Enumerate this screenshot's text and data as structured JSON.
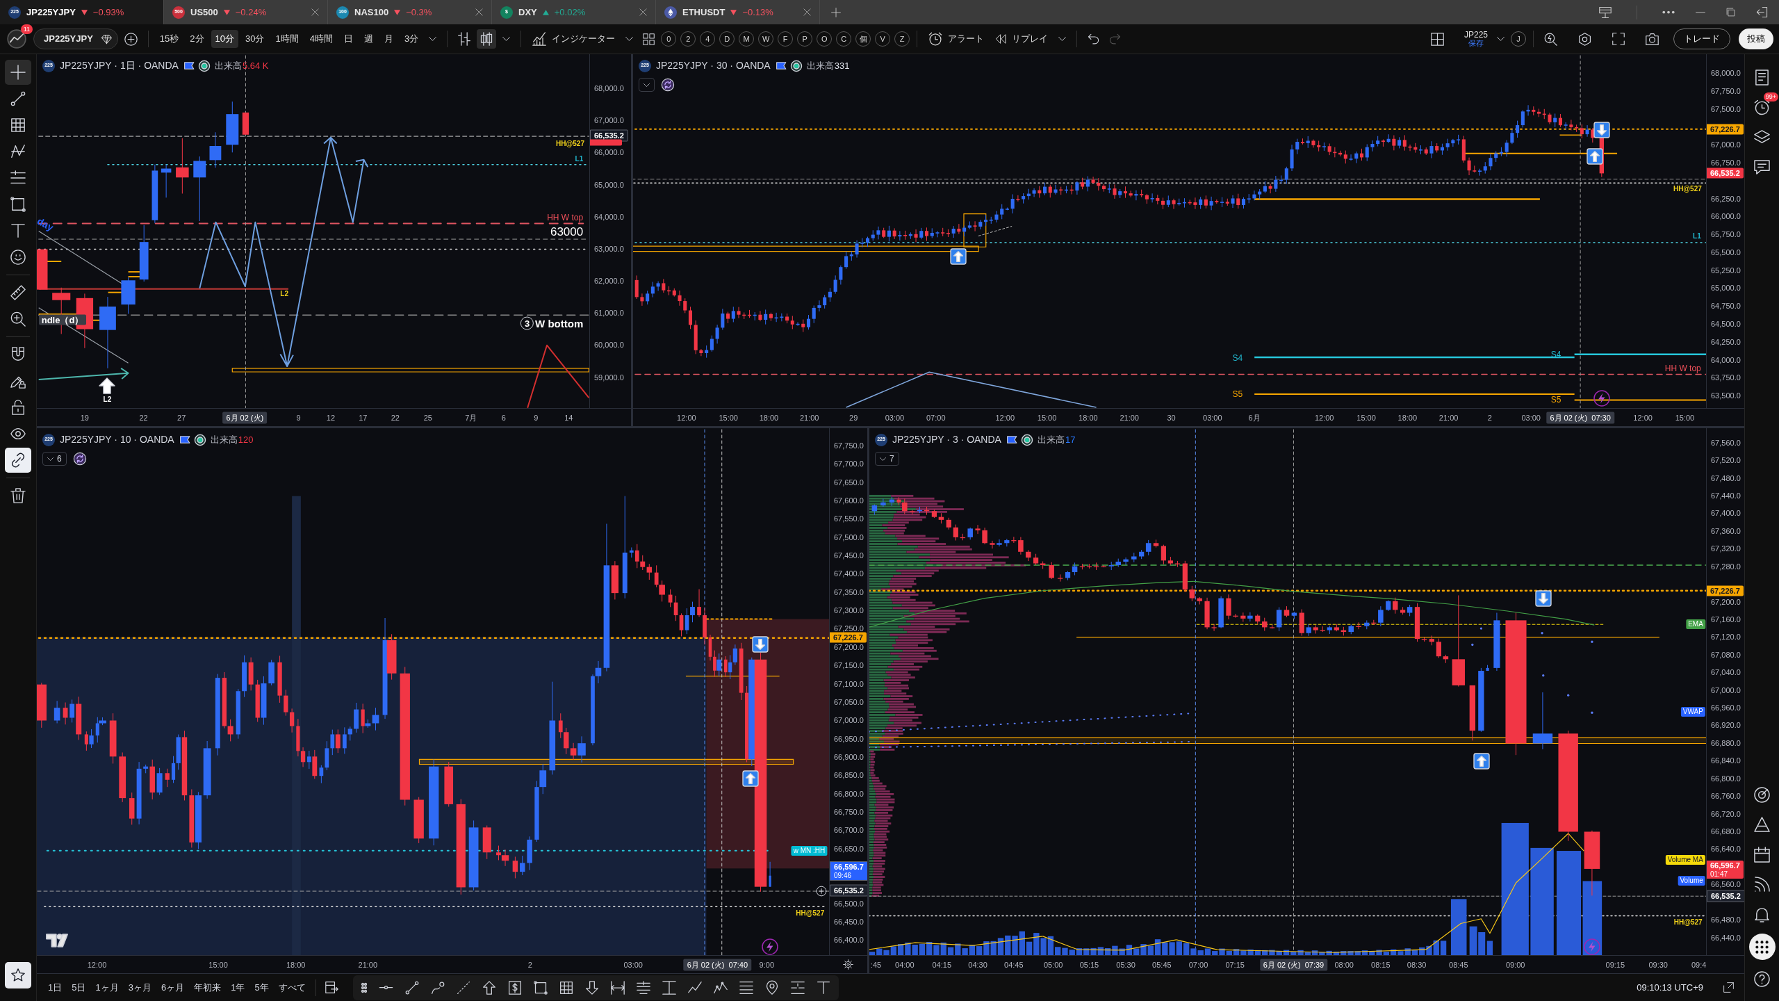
{
  "tabs": [
    {
      "badge": "225",
      "color": "#1f3e73",
      "symbol": "JP225YJPY",
      "change": "−0.93%",
      "negative": true,
      "selected": true,
      "closable": false
    },
    {
      "badge": "500",
      "color": "#c9303c",
      "symbol": "US500",
      "change": "−0.24%",
      "negative": true,
      "selected": false,
      "closable": true
    },
    {
      "badge": "100",
      "color": "#1b88b0",
      "symbol": "NAS100",
      "change": "−0.3%",
      "negative": true,
      "selected": false,
      "closable": true
    },
    {
      "badge": "$",
      "color": "#13835f",
      "symbol": "DXY",
      "change": "+0.02%",
      "negative": false,
      "selected": false,
      "closable": true
    },
    {
      "color": "#4b5aa6",
      "symbol": "ETHUSDT",
      "change": "−0.13%",
      "negative": true,
      "selected": false,
      "closable": true
    }
  ],
  "toolbar": {
    "notifications": "11",
    "symbol": "JP225YJPY",
    "intervals": [
      {
        "label": "15秒",
        "selected": false
      },
      {
        "label": "2分",
        "selected": false
      },
      {
        "label": "10分",
        "selected": true
      },
      {
        "label": "30分",
        "selected": false
      },
      {
        "label": "1時間",
        "selected": false
      },
      {
        "label": "4時間",
        "selected": false
      },
      {
        "label": "日",
        "selected": false
      },
      {
        "label": "週",
        "selected": false
      },
      {
        "label": "月",
        "selected": false
      },
      {
        "label": "3分",
        "selected": false
      }
    ],
    "chart_types": [
      {
        "kind": "bars",
        "selected": false
      },
      {
        "kind": "candles",
        "selected": true
      }
    ],
    "indicators": "インジケーター",
    "quick_buttons": [
      "0",
      "2",
      "4",
      "D",
      "M",
      "W",
      "F",
      "P",
      "O",
      "C",
      "個",
      "V",
      "Z"
    ],
    "alert": "アラート",
    "replay": "リプレイ",
    "undo_disabled": false,
    "redo_disabled": true,
    "layout_name": "JP225",
    "layout_status": "保存",
    "user_initial": "J",
    "trade": "トレード",
    "publish": "投稿"
  },
  "drawing_tools": [
    [
      {
        "kind": "crosshair",
        "selected": true
      },
      {
        "kind": "trend_line",
        "selected": false
      },
      {
        "kind": "grid",
        "selected": false
      },
      {
        "kind": "pattern",
        "selected": false
      },
      {
        "kind": "fib",
        "selected": false
      },
      {
        "kind": "rectangle",
        "selected": false
      },
      {
        "kind": "text",
        "selected": false
      },
      {
        "kind": "emoji",
        "selected": false
      }
    ],
    [
      {
        "kind": "ruler",
        "selected": false
      },
      {
        "kind": "zoom",
        "selected": false
      }
    ],
    [
      {
        "kind": "magnet",
        "selected": false
      },
      {
        "kind": "draw_lock",
        "selected": false
      },
      {
        "kind": "lock",
        "selected": false
      },
      {
        "kind": "eye",
        "selected": false
      },
      {
        "kind": "link",
        "selected": true
      }
    ],
    [
      {
        "kind": "trash",
        "selected": false
      }
    ]
  ],
  "side_panel": {
    "top": [
      {
        "kind": "watchlist",
        "selected": false
      },
      {
        "kind": "alerts",
        "badge": "99+",
        "selected": false
      },
      {
        "kind": "layers",
        "selected": false
      },
      {
        "kind": "chat",
        "selected": false
      }
    ],
    "bottom": [
      {
        "kind": "target",
        "selected": false
      },
      {
        "kind": "pyramid",
        "selected": false
      },
      {
        "kind": "calendar",
        "selected": false
      },
      {
        "kind": "broadcast",
        "selected": false
      },
      {
        "kind": "bell",
        "selected": false
      },
      {
        "kind": "apps",
        "selected": true
      },
      {
        "kind": "help",
        "selected": false
      }
    ]
  },
  "charts": [
    {
      "badge": "225",
      "title": "JP225YJPY · 1日 · OANDA",
      "volume": {
        "label": "出来高",
        "value": "5.64 K",
        "color": "#f23645"
      },
      "indicator_toggle": false,
      "linked": false,
      "price_ticks": [
        "68,000.0",
        "67,000.0",
        "66,000.0",
        "65,000.0",
        "64,000.0",
        "63,000.0",
        "62,000.0",
        "61,000.0",
        "60,000.0",
        "59,000.0"
      ],
      "price_badges": [
        {
          "text": "66,535.2",
          "color": "#131722"
        },
        {
          "color": "#f23645"
        }
      ],
      "time_ticks": [
        "19",
        "22",
        "27",
        "9",
        "12",
        "17",
        "22",
        "25",
        "7月",
        "6",
        "9",
        "14"
      ],
      "time_cursor": "6月 02 (火)",
      "labels": [
        {
          "kind": "text",
          "text": "HH@527",
          "color": "#f2d21b"
        },
        {
          "kind": "text",
          "text": "L1",
          "color": "#22b8cf"
        },
        {
          "kind": "text",
          "text": "HH W top",
          "color": "#f0505a"
        },
        {
          "kind": "text",
          "text": "63000",
          "color": "#ffffff"
        },
        {
          "kind": "numbered",
          "number": "3",
          "text": "W bottom",
          "color": "#ffffff"
        },
        {
          "kind": "text",
          "text": "L2",
          "color": "#f2d21b"
        },
        {
          "kind": "text",
          "text": "L2",
          "color": "#ffffff"
        },
        {
          "kind": "tag",
          "text": "ndle（d）",
          "color": "#3b3e46"
        },
        {
          "kind": "text",
          "text": "day",
          "color": "#2962ff"
        }
      ]
    },
    {
      "badge": "225",
      "title": "JP225YJPY · 30 · OANDA",
      "volume": {
        "label": "出来高",
        "value": "331",
        "color": "#e0e3eb"
      },
      "indicator_toggle": true,
      "linked": true,
      "price_ticks": [
        "68,000.0",
        "67,750.0",
        "67,500.0",
        "67,000.0",
        "66,750.0",
        "66,250.0",
        "66,000.0",
        "65,750.0",
        "65,500.0",
        "65,250.0",
        "65,000.0",
        "64,750.0",
        "64,500.0",
        "64,250.0",
        "64,000.0",
        "63,750.0",
        "63,500.0"
      ],
      "price_badges": [
        {
          "text": "67,226.7",
          "color": "#f7a600"
        },
        {
          "text": "66,535.2",
          "color": "#f23645"
        }
      ],
      "time_ticks": [
        "12:00",
        "15:00",
        "18:00",
        "21:00",
        "29",
        "03:00",
        "07:00",
        "12:00",
        "15:00",
        "18:00",
        "21:00",
        "30",
        "03:00",
        "6月",
        "12:00",
        "15:00",
        "18:00",
        "21:00",
        "2",
        "03:00",
        "12:00",
        "15:00"
      ],
      "time_cursor": "6月 02 (火)  07:30",
      "labels": [
        {
          "kind": "text",
          "text": "HH@527",
          "color": "#f2d21b"
        },
        {
          "kind": "text",
          "text": "L1",
          "color": "#22b8cf"
        },
        {
          "kind": "text",
          "text": "S4",
          "color": "#22b8cf"
        },
        {
          "kind": "text",
          "text": "S4",
          "color": "#22b8cf"
        },
        {
          "kind": "text",
          "text": "HH W top",
          "color": "#f0505a"
        },
        {
          "kind": "text",
          "text": "S5",
          "color": "#f7a600"
        },
        {
          "kind": "text",
          "text": "S5",
          "color": "#f7a600"
        }
      ],
      "signals": [
        {
          "kind": "up"
        },
        {
          "kind": "down"
        },
        {
          "kind": "up"
        }
      ]
    },
    {
      "badge": "225",
      "title": "JP225YJPY · 10 · OANDA",
      "volume": {
        "label": "出来高",
        "value": "120",
        "color": "#f23645"
      },
      "indicator_toggle": true,
      "indicator_count": "6",
      "linked": true,
      "price_ticks": [
        "67,750.0",
        "67,700.0",
        "67,650.0",
        "67,600.0",
        "67,550.0",
        "67,500.0",
        "67,450.0",
        "67,400.0",
        "67,350.0",
        "67,300.0",
        "67,250.0",
        "67,200.0",
        "67,150.0",
        "67,100.0",
        "67,050.0",
        "67,000.0",
        "66,950.0",
        "66,900.0",
        "66,850.0",
        "66,800.0",
        "66,750.0",
        "66,700.0",
        "66,650.0",
        "66,500.0",
        "66,450.0",
        "66,400.0"
      ],
      "price_badges": [
        {
          "text": "67,226.7",
          "color": "#f7a600"
        },
        {
          "text": "66,596.7",
          "time": "09:46",
          "color": "#2962ff"
        },
        {
          "text": "66,535.2",
          "color": "#1e222d"
        }
      ],
      "time_ticks": [
        "12:00",
        "15:00",
        "18:00",
        "21:00",
        "2",
        "03:00",
        "9:00"
      ],
      "time_cursor": "6月 02 (火)  07:40",
      "labels": [
        {
          "kind": "tag",
          "text": "w MN :HH",
          "color": "#00bcd4"
        },
        {
          "kind": "text",
          "text": "HH@527",
          "color": "#f2d21b"
        }
      ],
      "signals": [
        {
          "kind": "down"
        },
        {
          "kind": "up"
        }
      ]
    },
    {
      "badge": "225",
      "title": "JP225YJPY · 3 · OANDA",
      "volume": {
        "label": "出来高",
        "value": "17",
        "color": "#2979ff"
      },
      "indicator_toggle": true,
      "indicator_count": "7",
      "linked": false,
      "price_ticks": [
        "67,560.0",
        "67,520.0",
        "67,480.0",
        "67,440.0",
        "67,400.0",
        "67,360.0",
        "67,320.0",
        "67,280.0",
        "67,200.0",
        "67,160.0",
        "67,120.0",
        "67,080.0",
        "67,040.0",
        "67,000.0",
        "66,960.0",
        "66,920.0",
        "66,880.0",
        "66,840.0",
        "66,800.0",
        "66,760.0",
        "66,720.0",
        "66,680.0",
        "66,640.0",
        "66,560.0",
        "66,480.0",
        "66,440.0"
      ],
      "price_badges": [
        {
          "text": "67,226.7",
          "color": "#f7a600"
        },
        {
          "text": "66,596.7",
          "time": "01:47",
          "color": "#f23645"
        },
        {
          "text": "66,535.2",
          "color": "#1e222d"
        }
      ],
      "time_ticks": [
        ":45",
        "04:00",
        "04:15",
        "04:30",
        "04:45",
        "05:00",
        "05:15",
        "05:30",
        "05:45",
        "07:00",
        "07:15",
        "08:00",
        "08:15",
        "08:30",
        "08:45",
        "09:00",
        "09:15",
        "09:30",
        "09:4"
      ],
      "time_cursor": "6月 02 (火)  07:39",
      "labels": [
        {
          "kind": "tag",
          "text": "EMA",
          "color": "#43a047"
        },
        {
          "kind": "tag",
          "text": "VWAP",
          "color": "#2962ff"
        },
        {
          "kind": "tag",
          "text": "Volume MA",
          "color": "#f5d90a"
        },
        {
          "kind": "tag",
          "text": "Volume",
          "color": "#2962ff"
        },
        {
          "kind": "text",
          "text": "HH@527",
          "color": "#f2d21b"
        }
      ],
      "signals": [
        {
          "kind": "down"
        },
        {
          "kind": "up"
        }
      ]
    }
  ],
  "bottom_bar": {
    "ranges": [
      "1日",
      "5日",
      "1ヶ月",
      "3ヶ月",
      "6ヶ月",
      "年初来",
      "1年",
      "5年",
      "すべて"
    ],
    "clock": "09:10:13 UTC+9"
  }
}
